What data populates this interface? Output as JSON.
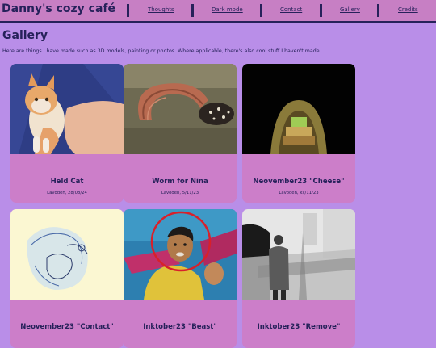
{
  "header": {
    "site_title": "Danny's cozy café",
    "nav": [
      {
        "label": "Thoughts"
      },
      {
        "label": "Dark mode"
      },
      {
        "label": "Contact"
      },
      {
        "label": "Gallery"
      },
      {
        "label": "Credits"
      }
    ]
  },
  "main": {
    "title": "Gallery",
    "intro": "Here are things I have made such as 3D models, painting or photos. Where applicable, there's also cool stuff I haven't made.",
    "items": [
      {
        "title": "Held Cat",
        "meta": "Lavoden, 28/08/24",
        "image": "cat-photo"
      },
      {
        "title": "Worm for Nina",
        "meta": "Lavoden, 5/11/23",
        "image": "worm-render"
      },
      {
        "title": "Neovember23 \"Cheese\"",
        "meta": "Lavoden, xx/11/23",
        "image": "cheese-render"
      },
      {
        "title": "Neovember23 \"Contact\"",
        "meta": "",
        "image": "contact-sketch"
      },
      {
        "title": "Inktober23 \"Beast\"",
        "meta": "",
        "image": "beast-painting"
      },
      {
        "title": "Inktober23 \"Remove\"",
        "meta": "",
        "image": "remove-painting"
      }
    ]
  }
}
